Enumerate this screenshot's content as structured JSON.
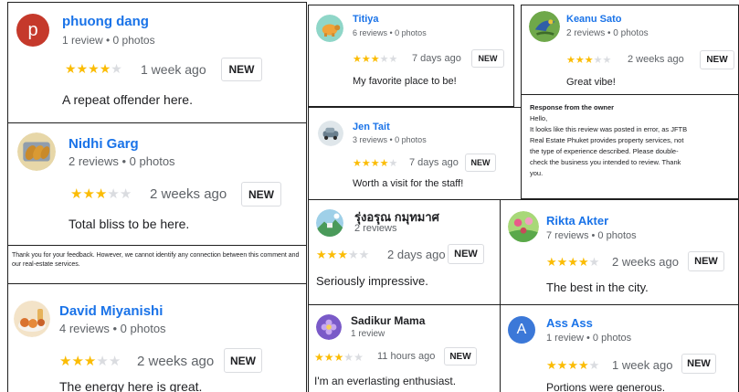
{
  "reviews": [
    {
      "name": "phuong dang",
      "meta": "1 review • 0 photos",
      "stars": 4,
      "time": "1 week ago",
      "badge": "NEW",
      "text": "A repeat offender here.",
      "avatar_letter": "p",
      "avatar_color": "#c5392b"
    },
    {
      "name": "Nidhi Garg",
      "meta": "2 reviews • 0 photos",
      "stars": 3,
      "time": "2 weeks ago",
      "badge": "NEW",
      "text": "Total bliss to be here.",
      "avatar_icon": "bread-icon"
    },
    {
      "name": "David Miyanishi",
      "meta": "4 reviews • 0 photos",
      "stars": 3,
      "time": "2 weeks ago",
      "badge": "NEW",
      "text": "The energy here is great.",
      "avatar_icon": "food-icon"
    },
    {
      "name": "Titiya",
      "meta": "6 reviews • 0 photos",
      "stars": 3,
      "time": "7 days ago",
      "badge": "NEW",
      "text": "My favorite place to be!",
      "avatar_icon": "turtle-icon"
    },
    {
      "name": "Jen Tait",
      "meta": "3 reviews • 0 photos",
      "stars": 4,
      "time": "7 days ago",
      "badge": "NEW",
      "text": "Worth a visit for the staff!",
      "avatar_icon": "car-icon"
    },
    {
      "name": "Keanu Sato",
      "meta": "2 reviews • 0 photos",
      "stars": 3,
      "time": "2 weeks ago",
      "badge": "NEW",
      "text": "Great vibe!",
      "avatar_icon": "bird-icon"
    },
    {
      "name": "รุ่งอรุณ กมุทมาศ",
      "meta": "2 reviews",
      "stars": 3,
      "time": "2 days ago",
      "badge": "NEW",
      "text": "Seriously impressive.",
      "avatar_icon": "landscape-icon"
    },
    {
      "name": "Sadikur Mama",
      "meta": "1 review",
      "stars": 3,
      "time": "11 hours ago",
      "badge": "NEW",
      "text": "I'm an everlasting enthusiast.",
      "avatar_icon": "flower-icon"
    },
    {
      "name": "Rikta Akter",
      "meta": "7 reviews • 0 photos",
      "stars": 4,
      "time": "2 weeks ago",
      "badge": "NEW",
      "text": "The best in the city.",
      "avatar_icon": "garden-icon"
    },
    {
      "name": "Ass Ass",
      "meta": "1 review • 0 photos",
      "stars": 4,
      "time": "1 week ago",
      "badge": "NEW",
      "text": "Portions were generous.",
      "avatar_letter": "A",
      "avatar_color": "#3b78d8"
    }
  ],
  "replies": {
    "feedback": "Thank you for your feedback. However, we cannot identify any connection between this comment and our real-estate services.",
    "owner_title": "Response from the owner",
    "owner_lines": [
      "Hello,",
      "It looks like this review was posted in error, as JFTB",
      "Real Estate Phuket provides property services, not",
      "the type of experience described. Please double-",
      "check the business you intended to review. Thank",
      "you."
    ]
  },
  "star_glyph": "★"
}
